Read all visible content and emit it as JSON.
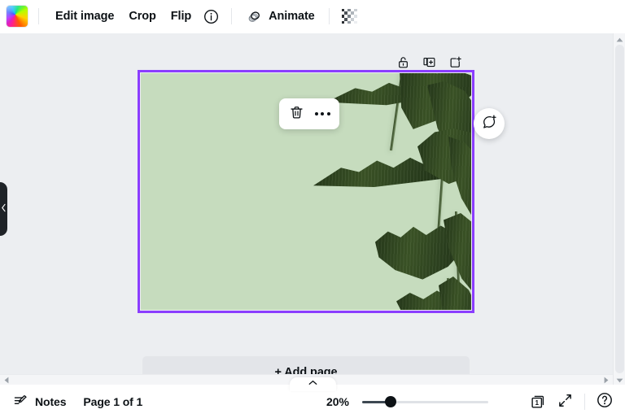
{
  "toolbar": {
    "thumbnail_name": "image-thumbnail",
    "items": [
      {
        "label": "Edit image",
        "name": "edit-image-button"
      },
      {
        "label": "Crop",
        "name": "crop-button"
      },
      {
        "label": "Flip",
        "name": "flip-button"
      }
    ],
    "info_icon": "info-icon",
    "animate_label": "Animate",
    "animate_icon": "animate-icon",
    "transparency_icon": "transparency-checker-icon"
  },
  "page_actions": {
    "lock_icon": "unlock-icon",
    "duplicate_icon": "duplicate-page-icon",
    "add_icon": "add-page-icon"
  },
  "element_toolbar": {
    "delete_icon": "trash-icon",
    "more_icon": "more-options-icon"
  },
  "comment": {
    "icon": "add-comment-icon"
  },
  "canvas": {
    "add_page_label": "+ Add page",
    "page_background_color": "#c6dcbe",
    "selection_color": "#8b3dff",
    "leaf_color": "#3c5527"
  },
  "sidebar": {
    "collapse_icon": "chevron-left-icon"
  },
  "scroll": {
    "left_arrow_icon": "scroll-left-icon",
    "right_arrow_icon": "scroll-right-icon",
    "up_arrow_icon": "scroll-up-icon",
    "down_arrow_icon": "scroll-down-icon",
    "expand_panel_icon": "chevron-up-icon"
  },
  "statusbar": {
    "notes_label": "Notes",
    "notes_icon": "notes-icon",
    "page_indicator": "Page 1 of 1",
    "zoom_level": "20%",
    "zoom_value": 20,
    "grid_view_icon": "page-grid-icon",
    "grid_view_count": "1",
    "fullscreen_icon": "fullscreen-icon",
    "help_icon": "help-icon"
  }
}
